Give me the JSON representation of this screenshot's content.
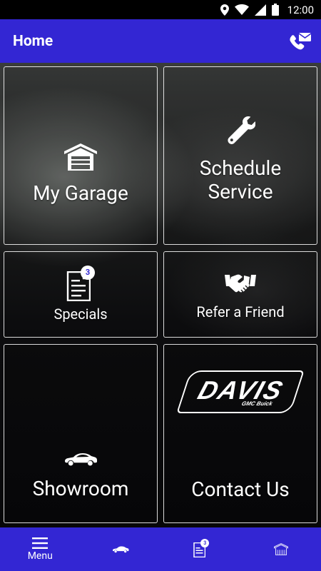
{
  "status_bar": {
    "time": "12:00",
    "icons": [
      "location-icon",
      "wifi-icon",
      "signal-icon",
      "battery-icon"
    ]
  },
  "app_bar": {
    "title": "Home",
    "action_icon": "phone-message-icon"
  },
  "tiles": {
    "my_garage": {
      "label": "My Garage",
      "icon": "garage-icon"
    },
    "schedule_service": {
      "label_line1": "Schedule",
      "label_line2": "Service",
      "icon": "wrench-icon"
    },
    "specials": {
      "label": "Specials",
      "icon": "document-icon",
      "badge": "3"
    },
    "refer_a_friend": {
      "label": "Refer a Friend",
      "icon": "handshake-icon"
    },
    "showroom": {
      "label": "Showroom",
      "icon": "car-icon"
    },
    "contact_us": {
      "label": "Contact Us",
      "logo": {
        "name": "DAVIS",
        "subtitle": "GMC Buick"
      }
    }
  },
  "bottom_nav": {
    "items": [
      {
        "label": "Menu",
        "icon": "hamburger-menu-icon"
      },
      {
        "label": "",
        "icon": "car-icon"
      },
      {
        "label": "",
        "icon": "document-icon",
        "badge": "3"
      },
      {
        "label": "",
        "icon": "garage-icon"
      }
    ]
  },
  "colors": {
    "primary": "#3326d3",
    "status_bar": "#000000",
    "tile_border": "#ffffff",
    "text": "#ffffff"
  }
}
